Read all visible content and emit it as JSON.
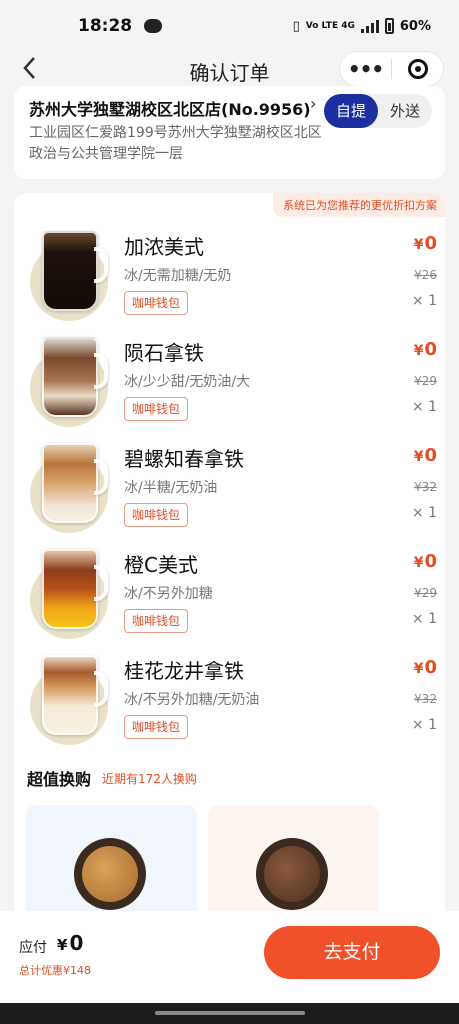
{
  "status_bar": {
    "time": "18:28",
    "network": "Vo LTE 4G",
    "battery": "60%"
  },
  "nav": {
    "back_icon": "chevron-left-icon",
    "title": "确认订单",
    "more_icon": "more-dots-icon",
    "more_glyph": "•••",
    "close_icon": "target-icon"
  },
  "store": {
    "name": "苏州大学独墅湖校区北区店(No.9956)",
    "arrow": "›",
    "address": "工业园区仁爱路199号苏州大学独墅湖校区北区政治与公共管理学院一层",
    "modes": [
      "自提",
      "外送"
    ],
    "active_mode": "自提"
  },
  "order": {
    "promo_tag": "系统已为您推荐的更优折扣方案",
    "currency": "¥",
    "items": [
      {
        "name": "加浓美式",
        "spec": "冰/无需加糖/无奶",
        "badge": "咖啡钱包",
        "price": "0",
        "original_price": "¥26",
        "qty": "× 1"
      },
      {
        "name": "陨石拿铁",
        "spec": "冰/少少甜/无奶油/大",
        "badge": "咖啡钱包",
        "price": "0",
        "original_price": "¥29",
        "qty": "× 1"
      },
      {
        "name": "碧螺知春拿铁",
        "spec": "冰/半糖/无奶油",
        "badge": "咖啡钱包",
        "price": "0",
        "original_price": "¥32",
        "qty": "× 1"
      },
      {
        "name": "橙C美式",
        "spec": "冰/不另外加糖",
        "badge": "咖啡钱包",
        "price": "0",
        "original_price": "¥29",
        "qty": "× 1"
      },
      {
        "name": "桂花龙井拿铁",
        "spec": "冰/不另外加糖/无奶油",
        "badge": "咖啡钱包",
        "price": "0",
        "original_price": "¥32",
        "qty": "× 1"
      }
    ]
  },
  "upsell": {
    "title": "超值换购",
    "subtitle": "近期有172人换购"
  },
  "checkout": {
    "due_label": "应付",
    "currency": "¥",
    "due_amount": "0",
    "total_saving": "总计优惠¥148",
    "pay_button": "去支付"
  },
  "colors": {
    "accent": "#f0512a",
    "price_red": "#e24d23",
    "active_mode_bg": "#1a2fa0"
  }
}
